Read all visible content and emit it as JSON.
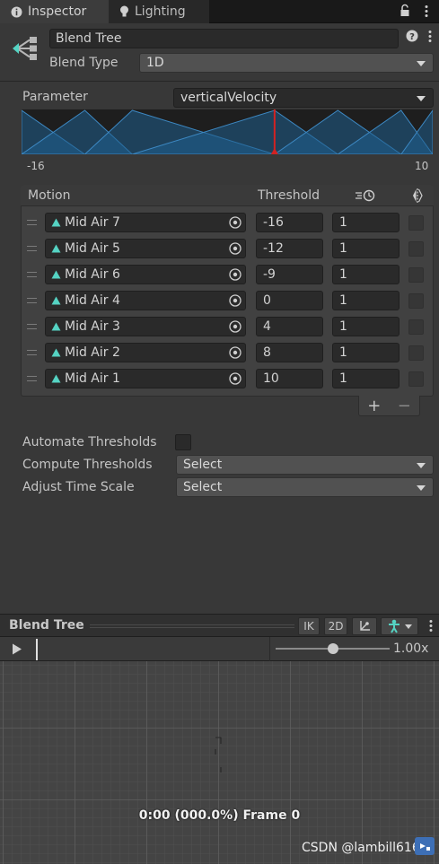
{
  "tabs": [
    {
      "label": "Inspector",
      "icon": "info-icon"
    },
    {
      "label": "Lighting",
      "icon": "lightbulb-icon"
    }
  ],
  "header": {
    "name": "Blend Tree",
    "blend_type_label": "Blend Type",
    "blend_type_value": "1D"
  },
  "parameter": {
    "label": "Parameter",
    "value": "verticalVelocity",
    "min": -16,
    "max": 10,
    "min_label": "-16",
    "max_label": "10",
    "current_value": 0
  },
  "motion_table": {
    "headers": {
      "motion": "Motion",
      "threshold": "Threshold",
      "speed_icon": "clock-speed-icon",
      "mirror_icon": "mirror-icon"
    },
    "rows": [
      {
        "motion": "Mid Air 7",
        "threshold": "-16",
        "speed": "1"
      },
      {
        "motion": "Mid Air 5",
        "threshold": "-12",
        "speed": "1"
      },
      {
        "motion": "Mid Air 6",
        "threshold": "-9",
        "speed": "1"
      },
      {
        "motion": "Mid Air 4",
        "threshold": "0",
        "speed": "1"
      },
      {
        "motion": "Mid Air 3",
        "threshold": "4",
        "speed": "1"
      },
      {
        "motion": "Mid Air 2",
        "threshold": "8",
        "speed": "1"
      },
      {
        "motion": "Mid Air 1",
        "threshold": "10",
        "speed": "1"
      }
    ],
    "add_label": "+",
    "remove_label": "−"
  },
  "options": {
    "automate_label": "Automate Thresholds",
    "compute_label": "Compute Thresholds",
    "compute_value": "Select",
    "adjust_label": "Adjust Time Scale",
    "adjust_value": "Select"
  },
  "preview": {
    "title": "Blend Tree",
    "ik_label": "IK",
    "twod_label": "2D",
    "speed_label": "1.00x",
    "speed_fraction": 0.5,
    "status": "0:00 (000.0%) Frame 0"
  },
  "watermark": "CSDN @lambill616",
  "colors": {
    "graph_fill": "#1f5e8e",
    "graph_line": "#3d88c2",
    "marker": "#d32222",
    "accent_icon": "#55d3c3"
  }
}
